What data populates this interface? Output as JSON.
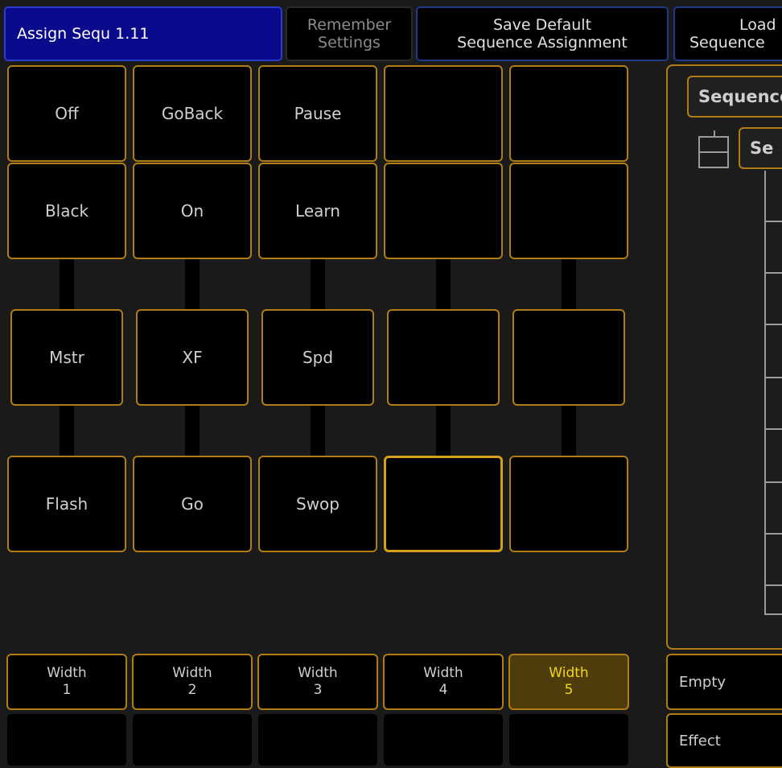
{
  "header": {
    "title": "Assign Sequ 1.11",
    "remember_line1": "Remember",
    "remember_line2": "Settings",
    "save_line1": "Save Default",
    "save_line2": "Sequence Assignment",
    "load_line1": "Load",
    "load_line2": "Sequence"
  },
  "grid": {
    "row1": [
      "Off",
      "GoBack",
      "Pause",
      "",
      ""
    ],
    "row2": [
      "Black",
      "On",
      "Learn",
      "",
      ""
    ],
    "row3": [
      "Mstr",
      "XF",
      "Spd",
      "",
      ""
    ],
    "row4": [
      "Flash",
      "Go",
      "Swop",
      "",
      ""
    ]
  },
  "width_buttons": [
    {
      "label": "Width",
      "num": "1"
    },
    {
      "label": "Width",
      "num": "2"
    },
    {
      "label": "Width",
      "num": "3"
    },
    {
      "label": "Width",
      "num": "4"
    },
    {
      "label": "Width",
      "num": "5",
      "active": true
    }
  ],
  "right_panel": {
    "tree_root": "Sequence",
    "tree_child": "Se",
    "empty_label": "Empty",
    "effect_label": "Effect"
  },
  "colors": {
    "accent_border": "#b07d14",
    "title_bg": "#0a0a8c",
    "active_bg": "#4e3c0c",
    "active_text": "#f1d81c"
  }
}
